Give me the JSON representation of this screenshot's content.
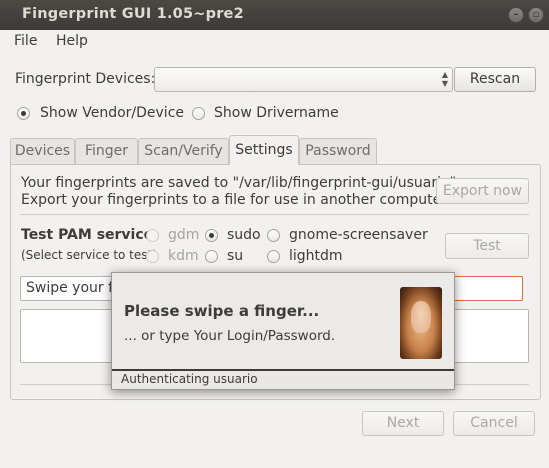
{
  "window": {
    "title": "Fingerprint GUI 1.05~pre2",
    "controls": [
      "minimize-icon",
      "maximize-icon",
      "close-icon"
    ]
  },
  "menu": {
    "file": "File",
    "help": "Help"
  },
  "devices": {
    "label": "Fingerprint Devices:",
    "value": "",
    "rescan": "Rescan"
  },
  "display_mode": {
    "options": [
      "Show Vendor/Device",
      "Show Drivername"
    ],
    "selected": "Show Vendor/Device"
  },
  "tabs": [
    {
      "label": "Devices",
      "active": false
    },
    {
      "label": "Finger",
      "active": false
    },
    {
      "label": "Scan/Verify",
      "active": false
    },
    {
      "label": "Settings",
      "active": true
    },
    {
      "label": "Password",
      "active": false
    }
  ],
  "settings": {
    "saved_line1": "Your fingerprints are saved to \"/var/lib/fingerprint-gui/usuario\"",
    "saved_line2": "Export your fingerprints to a file for use in another computer.",
    "export_button": "Export now",
    "pam_title": "Test PAM service",
    "pam_hint": "(Select service to test)",
    "services": [
      {
        "name": "gdm",
        "enabled": false,
        "selected": false
      },
      {
        "name": "sudo",
        "enabled": true,
        "selected": true
      },
      {
        "name": "gnome-screensaver",
        "enabled": true,
        "selected": false
      },
      {
        "name": "kdm",
        "enabled": false,
        "selected": false
      },
      {
        "name": "su",
        "enabled": true,
        "selected": false
      },
      {
        "name": "lightdm",
        "enabled": true,
        "selected": false
      }
    ],
    "test_button": "Test",
    "swipe_text": "Swipe your fi"
  },
  "popup": {
    "heading": "Please swipe a finger...",
    "subtext": "... or type Your Login/Password.",
    "status": "Authenticating usuario"
  },
  "footer": {
    "next": "Next",
    "cancel": "Cancel"
  },
  "colors": {
    "titlebar": "#3c3b37",
    "window_bg": "#f2f1f0",
    "error_border": "#e06a55"
  }
}
